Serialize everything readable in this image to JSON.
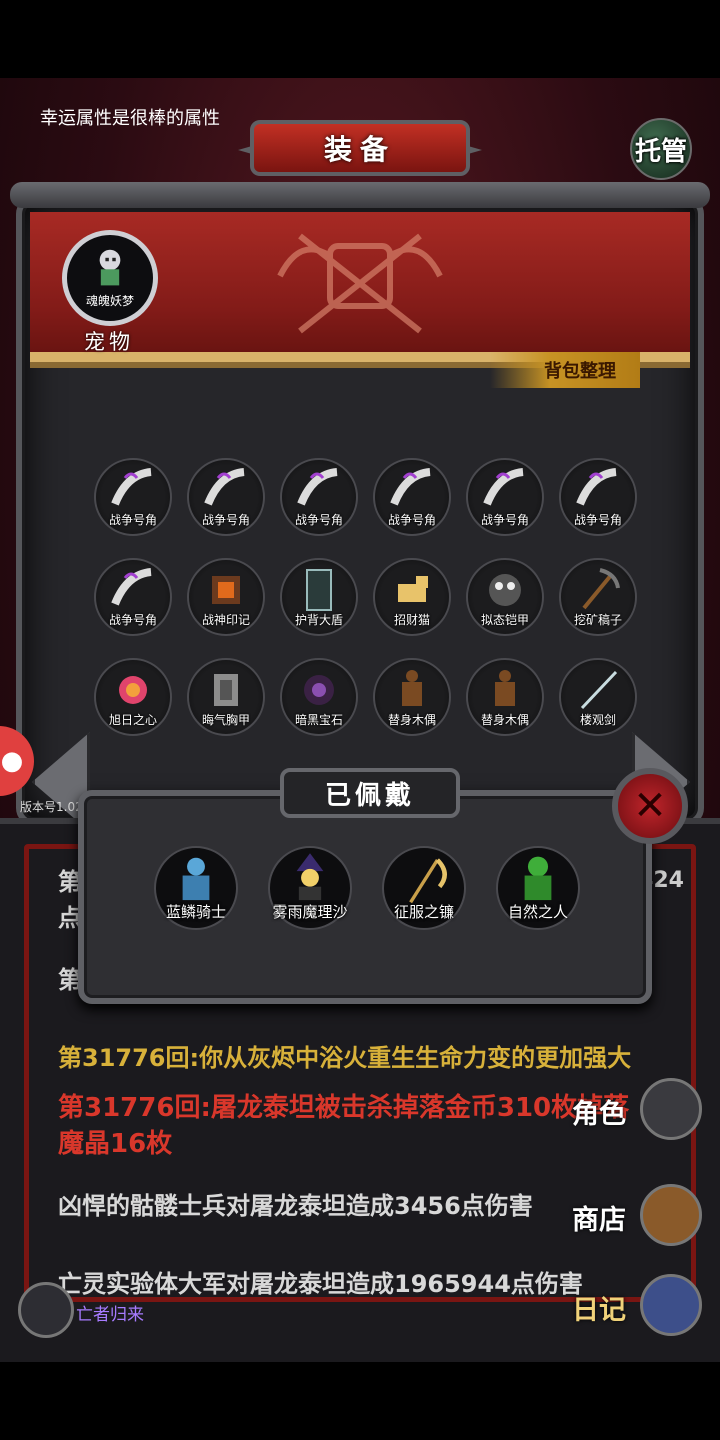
{
  "hint": "幸运属性是很棒的属性",
  "auto_label": "托管",
  "panel": {
    "title": "装备",
    "sort_button": "背包整理",
    "pet_name": "魂魄妖梦",
    "pet_label": "宠物"
  },
  "items": [
    {
      "label": "战争号角",
      "icon": "horn-icon"
    },
    {
      "label": "战争号角",
      "icon": "horn-icon"
    },
    {
      "label": "战争号角",
      "icon": "horn-icon"
    },
    {
      "label": "战争号角",
      "icon": "horn-icon"
    },
    {
      "label": "战争号角",
      "icon": "horn-icon"
    },
    {
      "label": "战争号角",
      "icon": "horn-icon"
    },
    {
      "label": "战争号角",
      "icon": "horn-icon"
    },
    {
      "label": "战神印记",
      "icon": "mark-icon"
    },
    {
      "label": "护背大盾",
      "icon": "shield-icon"
    },
    {
      "label": "招财猫",
      "icon": "cat-icon"
    },
    {
      "label": "拟态铠甲",
      "icon": "armor-icon"
    },
    {
      "label": "挖矿稿子",
      "icon": "pickaxe-icon"
    },
    {
      "label": "旭日之心",
      "icon": "heart-icon"
    },
    {
      "label": "晦气胸甲",
      "icon": "chestplate-icon"
    },
    {
      "label": "暗黑宝石",
      "icon": "gem-icon"
    },
    {
      "label": "替身木偶",
      "icon": "puppet-icon"
    },
    {
      "label": "替身木偶",
      "icon": "puppet-icon"
    },
    {
      "label": "楼观剑",
      "icon": "sword-icon"
    }
  ],
  "worn": {
    "title": "已佩戴",
    "items": [
      {
        "label": "蓝鳞骑士",
        "icon": "knight-icon"
      },
      {
        "label": "雾雨魔理沙",
        "icon": "witch-icon"
      },
      {
        "label": "征服之镰",
        "icon": "scythe-icon"
      },
      {
        "label": "自然之人",
        "icon": "nature-icon"
      }
    ]
  },
  "version": "版本号1.02",
  "log": {
    "partial1": "第",
    "partial2": "点",
    "partial3": "第",
    "number_right": "424",
    "line1": "第31776回:你从灰烬中浴火重生生命力变的更加强大",
    "line2": "第31776回:屠龙泰坦被击杀掉落金币310枚掉落",
    "line3": "魔晶16枚",
    "line4": "凶悍的骷髅士兵对屠龙泰坦造成3456点伤害",
    "line5": "亡灵实验体大军对屠龙泰坦造成1965944点伤害"
  },
  "side_buttons": {
    "role": "角色",
    "shop": "商店",
    "diary": "日记"
  },
  "bottom_name": "亡者归来",
  "colors": {
    "log_yellow": "#d8b13a",
    "log_red": "#d9372b",
    "log_white": "#d8d8d8"
  }
}
